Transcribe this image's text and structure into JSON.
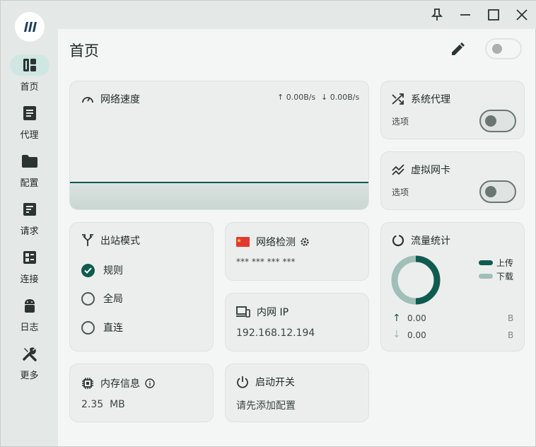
{
  "window": {
    "title_buttons": [
      "pin-icon",
      "minimize-icon",
      "maximize-icon",
      "close-icon"
    ]
  },
  "sidebar": {
    "items": [
      {
        "label": "首页",
        "icon": "dashboard-icon",
        "active": true
      },
      {
        "label": "代理",
        "icon": "article-icon",
        "active": false
      },
      {
        "label": "配置",
        "icon": "folder-icon",
        "active": false
      },
      {
        "label": "请求",
        "icon": "request-list-icon",
        "active": false
      },
      {
        "label": "连接",
        "icon": "connection-icon",
        "active": false
      },
      {
        "label": "日志",
        "icon": "android-icon",
        "active": false
      },
      {
        "label": "更多",
        "icon": "tools-icon",
        "active": false
      }
    ]
  },
  "header": {
    "title": "首页",
    "toggle_on": false
  },
  "network_speed": {
    "title": "网络速度",
    "upload": "↑ 0.00B/s",
    "download": "↓ 0.00B/s"
  },
  "system_proxy": {
    "title": "系统代理",
    "option_label": "选项",
    "enabled": false
  },
  "virtual_nic": {
    "title": "虚拟网卡",
    "option_label": "选项",
    "enabled": false
  },
  "outbound_mode": {
    "title": "出站模式",
    "options": [
      {
        "label": "规则",
        "checked": true
      },
      {
        "label": "全局",
        "checked": false
      },
      {
        "label": "直连",
        "checked": false
      }
    ]
  },
  "network_check": {
    "title": "网络检测",
    "value": "*** *** *** ***"
  },
  "intranet_ip": {
    "title": "内网 IP",
    "value": "192.168.12.194"
  },
  "traffic_stats": {
    "title": "流量统计",
    "legend": [
      {
        "label": "上传",
        "color": "#0f5b4f"
      },
      {
        "label": "下载",
        "color": "#9fbfb8"
      }
    ],
    "upload_value": "0.00",
    "download_value": "0.00",
    "unit": "B"
  },
  "memory": {
    "title": "内存信息",
    "value": "2.35  MB"
  },
  "launch_switch": {
    "title": "启动开关",
    "value": "请先添加配置"
  },
  "colors": {
    "accent": "#0f5b4f",
    "accent_light": "#9fbfb8",
    "active_pill": "#cfe7e2"
  }
}
